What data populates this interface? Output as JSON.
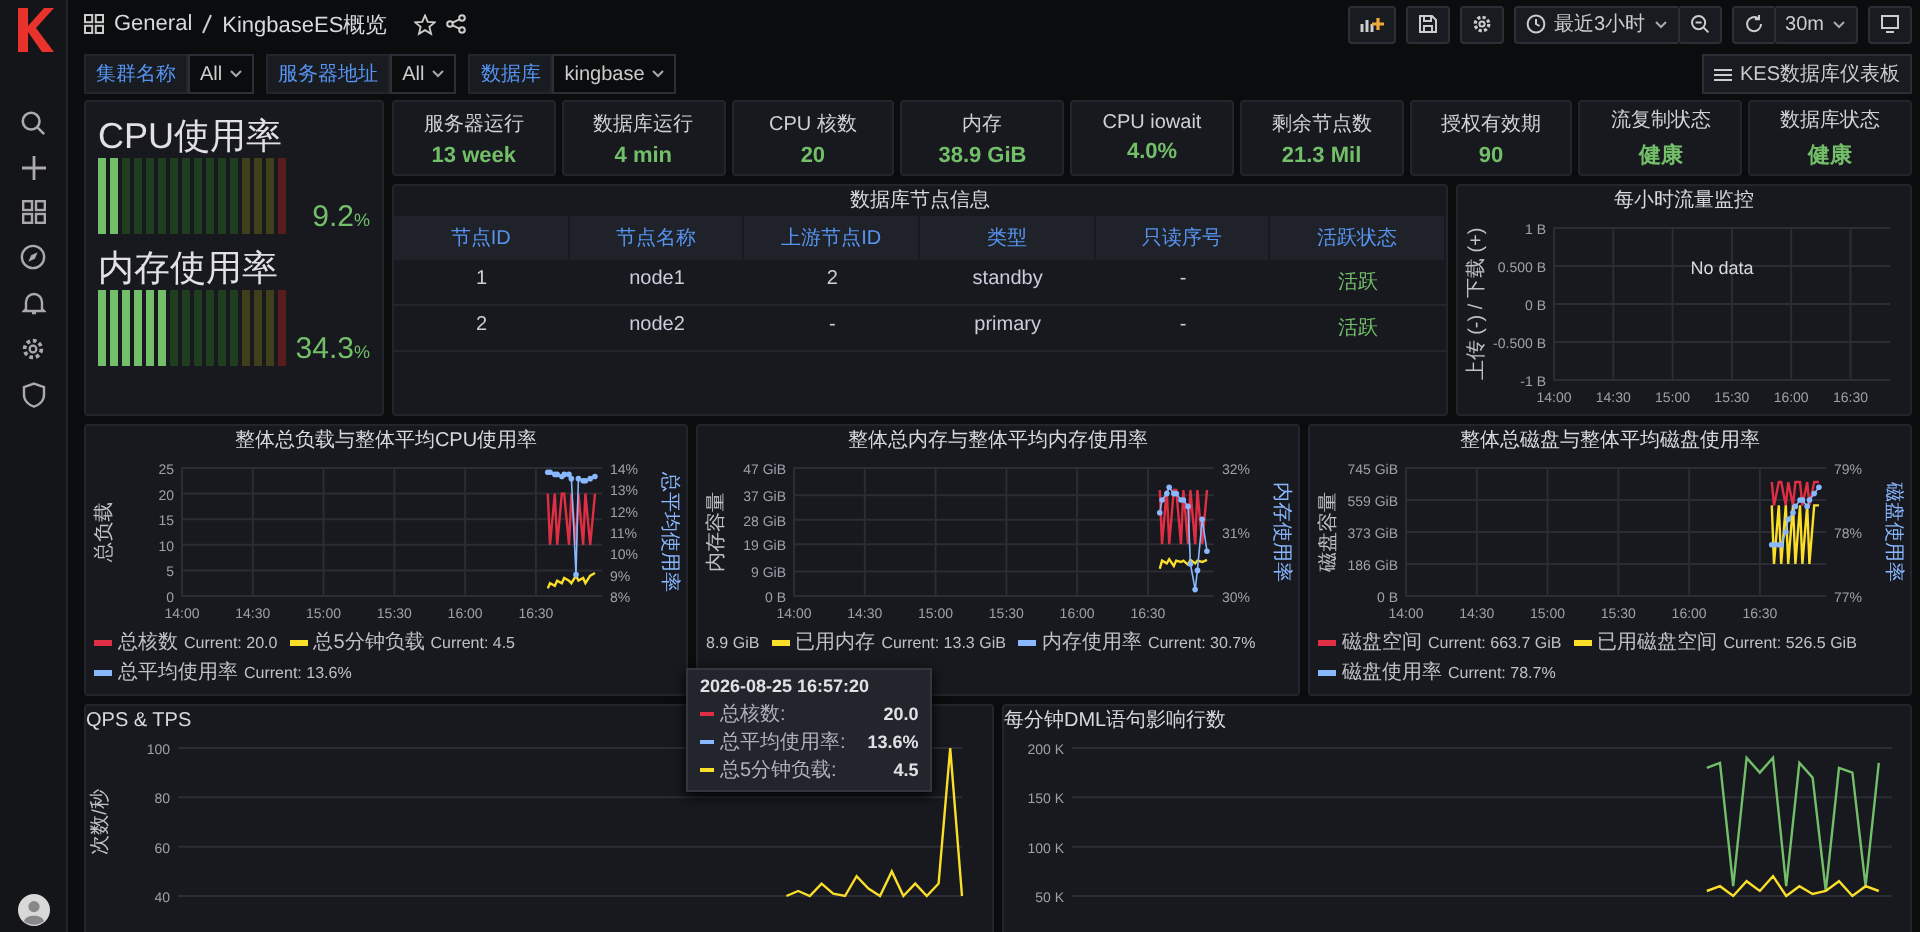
{
  "breadcrumb": {
    "folder": "General",
    "dashboard": "KingbaseES概览"
  },
  "toolbar": {
    "time_range": "最近3小时",
    "refresh_interval": "30m"
  },
  "variables": [
    {
      "label": "集群名称",
      "value": "All"
    },
    {
      "label": "服务器地址",
      "value": "All"
    },
    {
      "label": "数据库",
      "value": "kingbase"
    }
  ],
  "dashboard_link": "KES数据库仪表板",
  "gauges": [
    {
      "title": "CPU使用率",
      "value": "9.2",
      "unit": "%",
      "level": 0.092
    },
    {
      "title": "内存使用率",
      "value": "34.3",
      "unit": "%",
      "level": 0.343
    }
  ],
  "stats": [
    {
      "title": "服务器运行",
      "value": "13 week"
    },
    {
      "title": "数据库运行",
      "value": "4 min"
    },
    {
      "title": "CPU 核数",
      "value": "20"
    },
    {
      "title": "内存",
      "value": "38.9 GiB"
    },
    {
      "title": "CPU iowait",
      "value": "4.0%"
    },
    {
      "title": "剩余节点数",
      "value": "21.3 Mil"
    },
    {
      "title": "授权有效期",
      "value": "90"
    },
    {
      "title": "流复制状态",
      "value": "健康"
    },
    {
      "title": "数据库状态",
      "value": "健康"
    }
  ],
  "node_table": {
    "title": "数据库节点信息",
    "columns": [
      "节点ID",
      "节点名称",
      "上游节点ID",
      "类型",
      "只读序号",
      "活跃状态"
    ],
    "rows": [
      {
        "cells": [
          "1",
          "node1",
          "2",
          "standby",
          "-",
          "活跃"
        ]
      },
      {
        "cells": [
          "2",
          "node2",
          "-",
          "primary",
          "-",
          "活跃"
        ]
      }
    ]
  },
  "traffic_panel": {
    "title": "每小时流量监控",
    "message": "No data",
    "chart_data": {
      "type": "line",
      "grid": true,
      "ylabel": "上传 (-) / 下载 (+)",
      "xlim": [
        840,
        1010
      ],
      "ylim": [
        -1,
        1
      ],
      "xticks": [
        {
          "value": 840,
          "label": "14:00"
        },
        {
          "value": 870,
          "label": "14:30"
        },
        {
          "value": 900,
          "label": "15:00"
        },
        {
          "value": 930,
          "label": "15:30"
        },
        {
          "value": 960,
          "label": "16:00"
        },
        {
          "value": 990,
          "label": "16:30"
        }
      ],
      "yticks": [
        {
          "value": 1,
          "label": "1 B"
        },
        {
          "value": 0.5,
          "label": "0.500 B"
        },
        {
          "value": 0,
          "label": "0 B"
        },
        {
          "value": -0.5,
          "label": "-0.500 B"
        },
        {
          "value": -1,
          "label": "-1 B"
        }
      ]
    }
  },
  "charts": [
    {
      "title": "整体总负载与整体平均CPU使用率",
      "chart_data": {
        "type": "line",
        "grid": true,
        "ylabel": "总负载",
        "y2label": "总平均使用率",
        "xlim": [
          840,
          1018
        ],
        "ylim": [
          0,
          25
        ],
        "y2lim": [
          8,
          14
        ],
        "x": [
          995,
          996,
          998,
          999,
          1001,
          1002,
          1004,
          1005,
          1007,
          1008,
          1010,
          1011,
          1013,
          1015
        ],
        "xticks": [
          {
            "value": 840,
            "label": "14:00"
          },
          {
            "value": 870,
            "label": "14:30"
          },
          {
            "value": 900,
            "label": "15:00"
          },
          {
            "value": 930,
            "label": "15:30"
          },
          {
            "value": 960,
            "label": "16:00"
          },
          {
            "value": 990,
            "label": "16:30"
          }
        ],
        "yticks": [
          0,
          5,
          10,
          15,
          20,
          25
        ],
        "y2ticks": [
          {
            "value": 8,
            "label": "8%"
          },
          {
            "value": 9,
            "label": "9%"
          },
          {
            "value": 10,
            "label": "10%"
          },
          {
            "value": 11,
            "label": "11%"
          },
          {
            "value": 12,
            "label": "12%"
          },
          {
            "value": 13,
            "label": "13%"
          },
          {
            "value": 14,
            "label": "14%"
          }
        ],
        "series": [
          {
            "name": "总核数",
            "color": "#e02f44",
            "values": [
              20,
              10,
              20,
              10,
              20,
              20,
              10,
              20,
              10,
              20,
              10,
              20,
              10,
              20
            ]
          },
          {
            "name": "总5分钟负载",
            "color": "#fade2a",
            "values": [
              1.5,
              2.5,
              2,
              3,
              2.5,
              3.5,
              3,
              2.5,
              4,
              3,
              3.5,
              2.5,
              4,
              4.5
            ]
          },
          {
            "name": "总平均使用率",
            "color": "#8ab8ff",
            "axis": "y2",
            "values": [
              13.8,
              13.8,
              13.7,
              13.7,
              13.6,
              13.7,
              13.7,
              13.5,
              9,
              13.5,
              13.4,
              13.4,
              13.5,
              13.6
            ]
          }
        ]
      },
      "legend": [
        "Current: 20.0",
        "Current: 4.5",
        "Current: 13.6%"
      ]
    },
    {
      "title": "整体总内存与整体平均内存使用率",
      "chart_data": {
        "type": "line",
        "grid": true,
        "ylabel": "内存容量",
        "y2label": "内存使用率",
        "xlim": [
          840,
          1018
        ],
        "ylim": [
          0,
          47
        ],
        "y2lim": [
          30,
          32
        ],
        "x": [
          995,
          996,
          998,
          999,
          1001,
          1002,
          1004,
          1005,
          1007,
          1008,
          1010,
          1011,
          1013,
          1015
        ],
        "xticks": [
          {
            "value": 840,
            "label": "14:00"
          },
          {
            "value": 870,
            "label": "14:30"
          },
          {
            "value": 900,
            "label": "15:00"
          },
          {
            "value": 930,
            "label": "15:30"
          },
          {
            "value": 960,
            "label": "16:00"
          },
          {
            "value": 990,
            "label": "16:30"
          }
        ],
        "yticks": [
          {
            "value": 0,
            "label": "0 B"
          },
          {
            "value": 9,
            "label": "9 GiB"
          },
          {
            "value": 19,
            "label": "19 GiB"
          },
          {
            "value": 28,
            "label": "28 GiB"
          },
          {
            "value": 37,
            "label": "37 GiB"
          },
          {
            "value": 47,
            "label": "47 GiB"
          }
        ],
        "y2ticks": [
          {
            "value": 30,
            "label": "30%"
          },
          {
            "value": 31,
            "label": "31%"
          },
          {
            "value": 32,
            "label": "32%"
          }
        ],
        "series": [
          {
            "color": "#e02f44",
            "values": [
              38.9,
              19,
              38.9,
              19,
              38.9,
              38.9,
              19,
              38.9,
              19,
              38.9,
              19,
              38.9,
              19,
              38.9
            ]
          },
          {
            "name": "已用内存",
            "color": "#fade2a",
            "values": [
              10,
              13,
              12,
              13.5,
              11,
              13,
              12.5,
              13,
              11.5,
              13.3,
              12,
              13,
              12.5,
              13.3
            ]
          },
          {
            "name": "内存使用率",
            "color": "#8ab8ff",
            "axis": "y2",
            "values": [
              31.3,
              31.5,
              31.6,
              31.7,
              31.6,
              31.6,
              31.5,
              31.5,
              31.4,
              30.5,
              30.1,
              30.4,
              31.2,
              30.7
            ]
          }
        ]
      },
      "legend": [
        "8.9 GiB",
        "Current: 13.3 GiB",
        "Current: 30.7%"
      ]
    },
    {
      "title": "整体总磁盘与整体平均磁盘使用率",
      "chart_data": {
        "type": "line",
        "grid": true,
        "ylabel": "磁盘容量",
        "y2label": "磁盘使用率",
        "xlim": [
          840,
          1018
        ],
        "ylim": [
          0,
          745
        ],
        "y2lim": [
          77,
          79
        ],
        "x": [
          995,
          996,
          998,
          999,
          1001,
          1002,
          1004,
          1005,
          1007,
          1008,
          1010,
          1011,
          1013,
          1015
        ],
        "xticks": [
          {
            "value": 840,
            "label": "14:00"
          },
          {
            "value": 870,
            "label": "14:30"
          },
          {
            "value": 900,
            "label": "15:00"
          },
          {
            "value": 930,
            "label": "15:30"
          },
          {
            "value": 960,
            "label": "16:00"
          },
          {
            "value": 990,
            "label": "16:30"
          }
        ],
        "yticks": [
          {
            "value": 0,
            "label": "0 B"
          },
          {
            "value": 186,
            "label": "186 GiB"
          },
          {
            "value": 373,
            "label": "373 GiB"
          },
          {
            "value": 559,
            "label": "559 GiB"
          },
          {
            "value": 745,
            "label": "745 GiB"
          }
        ],
        "y2ticks": [
          {
            "value": 77,
            "label": "77%"
          },
          {
            "value": 78,
            "label": "78%"
          },
          {
            "value": 79,
            "label": "79%"
          }
        ],
        "series": [
          {
            "name": "磁盘空间",
            "color": "#e02f44",
            "values": [
              664,
              527,
              664,
              664,
              527,
              664,
              527,
              664,
              664,
              527,
              664,
              527,
              664,
              664
            ]
          },
          {
            "name": "已用磁盘空间",
            "color": "#fade2a",
            "values": [
              527,
              186,
              527,
              186,
              527,
              186,
              527,
              186,
              527,
              186,
              527,
              186,
              527,
              527
            ]
          },
          {
            "name": "磁盘使用率",
            "color": "#8ab8ff",
            "axis": "y2",
            "values": [
              77.8,
              77.8,
              77.8,
              77.8,
              78,
              78.2,
              78.3,
              78.4,
              78.5,
              78.5,
              78.4,
              78.5,
              78.6,
              78.7
            ]
          }
        ]
      },
      "legend": [
        "Current: 663.7 GiB",
        "Current: 526.5 GiB",
        "Current: 78.7%"
      ]
    }
  ],
  "bottom_panels": [
    {
      "title": "QPS & TPS",
      "chart_data": {
        "type": "line",
        "grid": true,
        "ylabel": "次数/秒",
        "ylim": [
          40,
          100
        ],
        "yticks": [
          100,
          80,
          60,
          40
        ],
        "series": [
          {
            "color": "#fade2a",
            "values": [
              null,
              null,
              null,
              null,
              null,
              null,
              null,
              null,
              null,
              null,
              null,
              null,
              null,
              null,
              null,
              null,
              null,
              null,
              null,
              null,
              null,
              null,
              null,
              null,
              null,
              null,
              null,
              null,
              null,
              null,
              null,
              null,
              null,
              null,
              null,
              null,
              null,
              null,
              null,
              null,
              null,
              null,
              null,
              null,
              null,
              null,
              null,
              null,
              null,
              null,
              null,
              null,
              40,
              42,
              40,
              45,
              41,
              40,
              48,
              43,
              40,
              50,
              40,
              45,
              40,
              45,
              100,
              40
            ]
          }
        ]
      }
    },
    {
      "title": "每分钟DML语句影响行数",
      "chart_data": {
        "type": "line",
        "grid": true,
        "ylim": [
          50000,
          200000
        ],
        "yticks": [
          {
            "value": 200000,
            "label": "200 K"
          },
          {
            "value": 150000,
            "label": "150 K"
          },
          {
            "value": 100000,
            "label": "100 K"
          },
          {
            "value": 50000,
            "label": "50 K"
          }
        ],
        "series": [
          {
            "color": "#73bf69",
            "values": [
              null,
              null,
              null,
              null,
              null,
              null,
              null,
              null,
              null,
              null,
              null,
              null,
              null,
              null,
              null,
              null,
              null,
              null,
              null,
              null,
              null,
              null,
              null,
              null,
              null,
              null,
              null,
              null,
              null,
              null,
              null,
              null,
              null,
              null,
              null,
              null,
              null,
              null,
              null,
              null,
              null,
              null,
              null,
              null,
              null,
              null,
              null,
              null,
              180000,
              185000,
              60000,
              190000,
              175000,
              190000,
              60000,
              185000,
              170000,
              55000,
              180000,
              175000,
              60000,
              185000,
              null
            ]
          },
          {
            "color": "#fade2a",
            "values": [
              null,
              null,
              null,
              null,
              null,
              null,
              null,
              null,
              null,
              null,
              null,
              null,
              null,
              null,
              null,
              null,
              null,
              null,
              null,
              null,
              null,
              null,
              null,
              null,
              null,
              null,
              null,
              null,
              null,
              null,
              null,
              null,
              null,
              null,
              null,
              null,
              null,
              null,
              null,
              null,
              null,
              null,
              null,
              null,
              null,
              null,
              null,
              null,
              55000,
              60000,
              50000,
              65000,
              55000,
              70000,
              50000,
              60000,
              52000,
              55000,
              65000,
              50000,
              60000,
              55000,
              null
            ]
          }
        ]
      }
    }
  ],
  "tooltip": {
    "time": "2026-08-25 16:57:20",
    "rows": [
      {
        "label": "总核数:",
        "value": "20.0",
        "color": "#e02f44"
      },
      {
        "label": "总平均使用率:",
        "value": "13.6%",
        "color": "#8ab8ff"
      },
      {
        "label": "总5分钟负载:",
        "value": "4.5",
        "color": "#fade2a"
      }
    ]
  }
}
